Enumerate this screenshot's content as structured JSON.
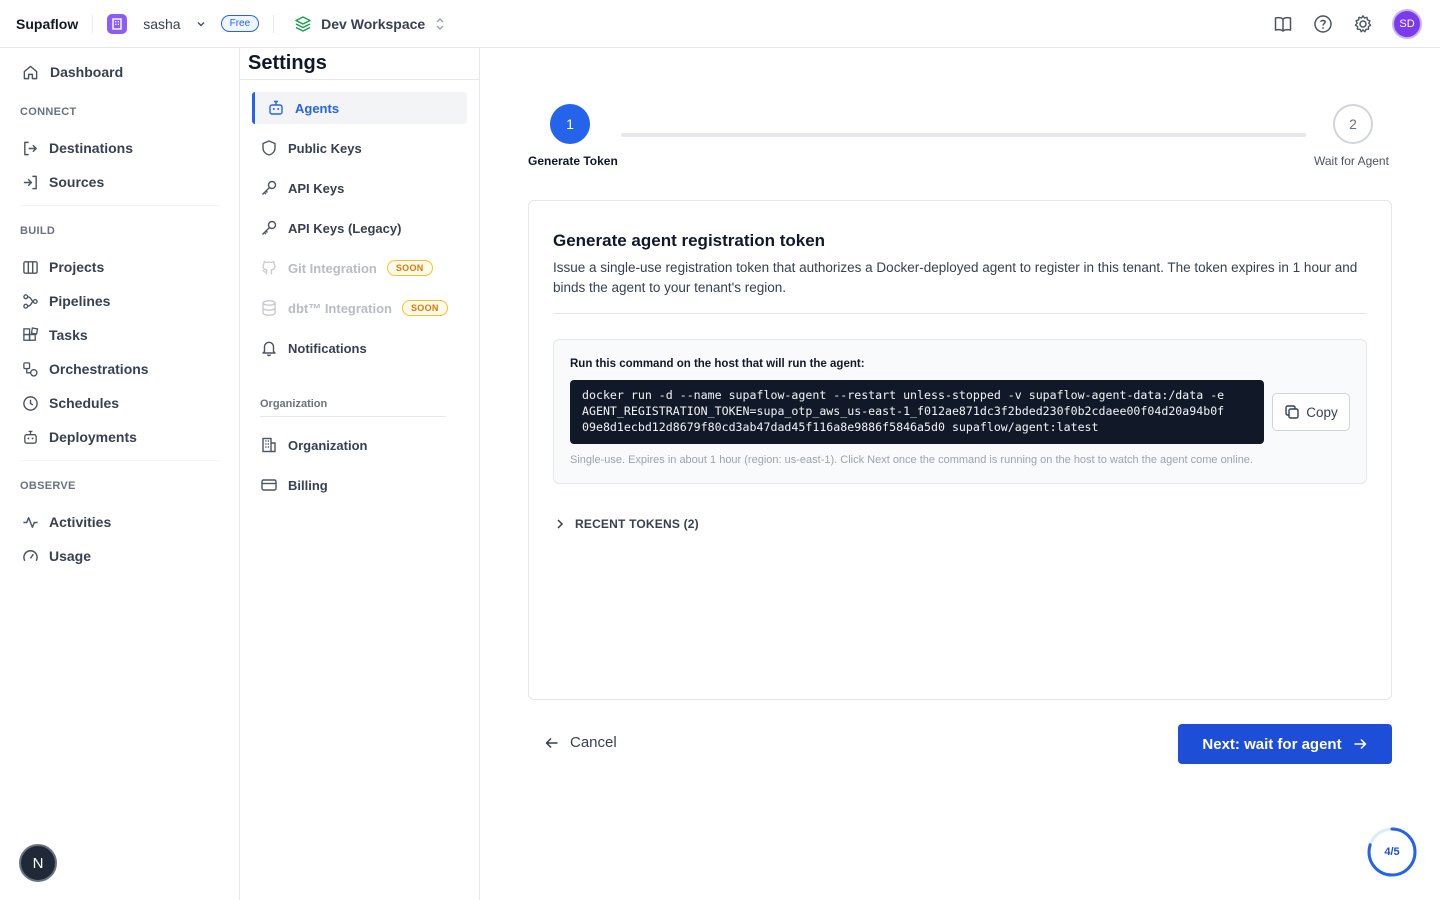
{
  "topbar": {
    "brand": "Supaflow",
    "tenant": "sasha",
    "plan": "Free",
    "workspace": "Dev Workspace",
    "avatar_initials": "SD",
    "accent": "#2563eb"
  },
  "sidebar": {
    "dashboard": "Dashboard",
    "sections": {
      "connect": "CONNECT",
      "build": "BUILD",
      "observe": "OBSERVE"
    },
    "items": {
      "destinations": "Destinations",
      "sources": "Sources",
      "projects": "Projects",
      "pipelines": "Pipelines",
      "tasks": "Tasks",
      "orchestrations": "Orchestrations",
      "schedules": "Schedules",
      "deployments": "Deployments",
      "activities": "Activities",
      "usage": "Usage"
    },
    "bottom_badge": "N"
  },
  "settings": {
    "title": "Settings",
    "items": {
      "agents": "Agents",
      "public_keys": "Public Keys",
      "api_keys": "API Keys",
      "api_keys_legacy": "API Keys (Legacy)",
      "git_integration": "Git Integration",
      "dbt_integration": "dbt™ Integration",
      "notifications": "Notifications"
    },
    "soon_badge": "SOON",
    "org_section": "Organization",
    "org_items": {
      "organization": "Organization",
      "billing": "Billing"
    }
  },
  "stepper": {
    "steps": [
      {
        "number": "1",
        "label": "Generate Token",
        "state": "active"
      },
      {
        "number": "2",
        "label": "Wait for Agent",
        "state": "pending"
      }
    ]
  },
  "card": {
    "title": "Generate agent registration token",
    "description": "Issue a single-use registration token that authorizes a Docker-deployed agent to register in this tenant. The token expires in 1 hour and binds the agent to your tenant's region.",
    "command_label": "Run this command on the host that will run the agent:",
    "command": "docker run -d --name supaflow-agent --restart unless-stopped -v supaflow-agent-data:/data -e\nAGENT_REGISTRATION_TOKEN=supa_otp_aws_us-east-1_f012ae871dc3f2bded230f0b2cdaee00f04d20a94b0f\n09e8d1ecbd12d8679f80cd3ab47dad45f116a8e9886f5846a5d0 supaflow/agent:latest",
    "copy_label": "Copy",
    "hint": "Single-use. Expires in about 1 hour (region: us-east-1). Click Next once the command is running on the host to watch the agent come online.",
    "recent_tokens": "RECENT TOKENS (2)"
  },
  "actions": {
    "cancel": "Cancel",
    "next": "Next: wait for agent"
  },
  "progress": {
    "label": "4/5",
    "fraction": 0.8
  }
}
